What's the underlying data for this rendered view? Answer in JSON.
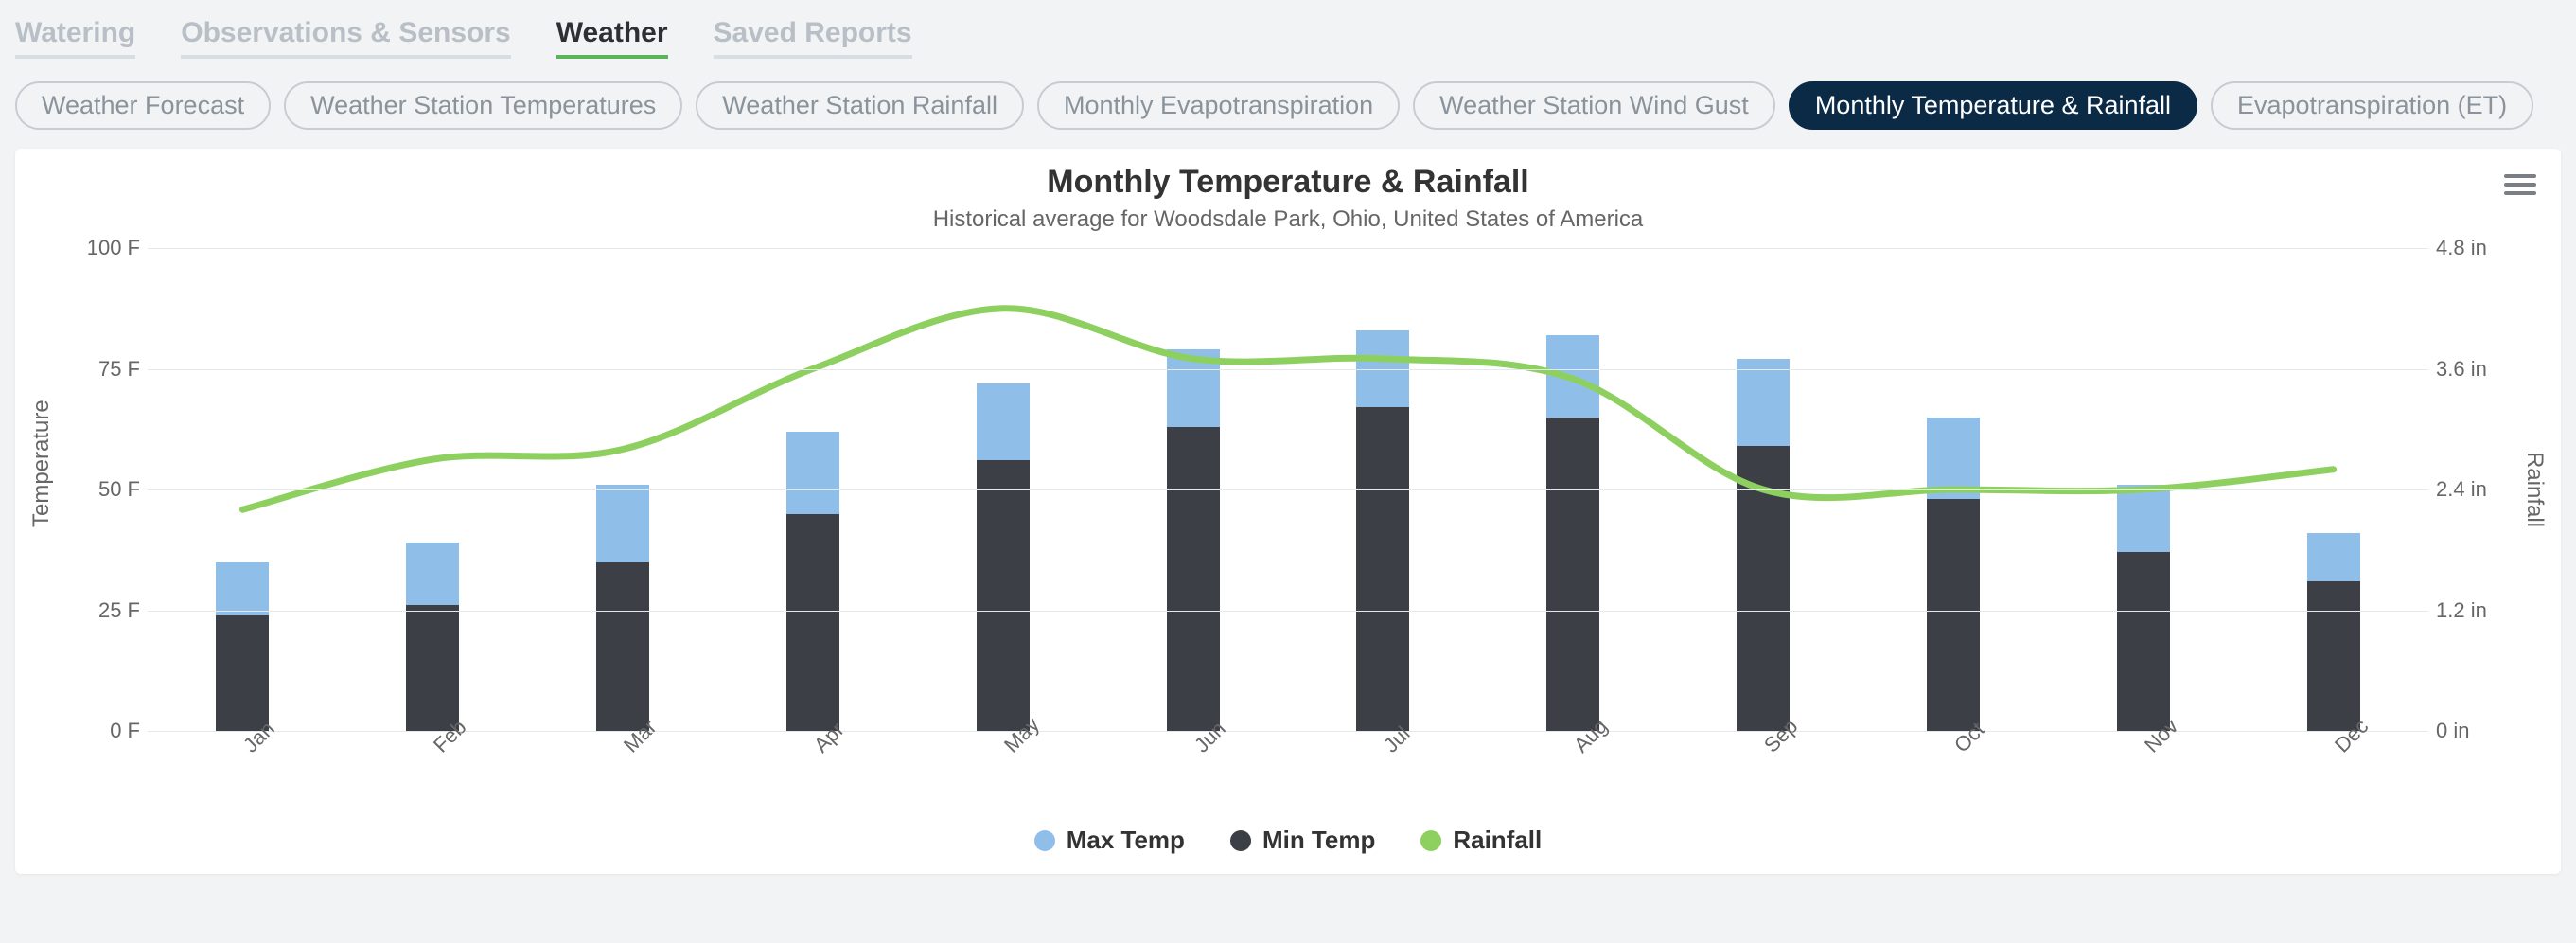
{
  "nav": {
    "tabs": [
      {
        "label": "Watering",
        "active": false
      },
      {
        "label": "Observations & Sensors",
        "active": false
      },
      {
        "label": "Weather",
        "active": true
      },
      {
        "label": "Saved Reports",
        "active": false
      }
    ]
  },
  "pills": [
    {
      "label": "Weather Forecast",
      "active": false
    },
    {
      "label": "Weather Station Temperatures",
      "active": false
    },
    {
      "label": "Weather Station Rainfall",
      "active": false
    },
    {
      "label": "Monthly Evapotranspiration",
      "active": false
    },
    {
      "label": "Weather Station Wind Gust",
      "active": false
    },
    {
      "label": "Monthly Temperature & Rainfall",
      "active": true
    },
    {
      "label": "Evapotranspiration (ET)",
      "active": false
    }
  ],
  "chart": {
    "title": "Monthly Temperature & Rainfall",
    "subtitle": "Historical average for Woodsdale Park, Ohio, United States of America",
    "yLeft": {
      "title": "Temperature",
      "min": 0,
      "max": 100,
      "unit": "F",
      "ticks": [
        0,
        25,
        50,
        75,
        100
      ]
    },
    "yRight": {
      "title": "Rainfall",
      "min": 0,
      "max": 4.8,
      "unit": "in",
      "ticks": [
        0,
        1.2,
        2.4,
        3.6,
        4.8
      ]
    },
    "legend": {
      "max": "Max Temp",
      "min": "Min Temp",
      "rain": "Rainfall"
    }
  },
  "chart_data": {
    "type": "bar+line",
    "title": "Monthly Temperature & Rainfall",
    "subtitle": "Historical average for Woodsdale Park, Ohio, United States of America",
    "xlabel": "",
    "ylabel_left": "Temperature",
    "ylabel_right": "Rainfall",
    "ylim_left": [
      0,
      100
    ],
    "ylim_right": [
      0,
      4.8
    ],
    "y_left_unit": "F",
    "y_right_unit": "in",
    "categories": [
      "Jan",
      "Feb",
      "Mar",
      "Apr",
      "May",
      "Jun",
      "Jul",
      "Aug",
      "Sep",
      "Oct",
      "Nov",
      "Dec"
    ],
    "series": [
      {
        "name": "Max Temp",
        "type": "bar",
        "axis": "left",
        "color": "#8fbfe8",
        "values": [
          35,
          39,
          51,
          62,
          72,
          79,
          83,
          82,
          77,
          65,
          51,
          41
        ]
      },
      {
        "name": "Min Temp",
        "type": "bar",
        "axis": "left",
        "color": "#3c3f46",
        "values": [
          24,
          26,
          35,
          45,
          56,
          63,
          67,
          65,
          59,
          48,
          37,
          31
        ]
      },
      {
        "name": "Rainfall",
        "type": "line",
        "axis": "right",
        "color": "#8ed060",
        "values": [
          2.2,
          2.7,
          2.8,
          3.6,
          4.2,
          3.7,
          3.7,
          3.5,
          2.4,
          2.4,
          2.4,
          2.6
        ]
      }
    ],
    "grid": true,
    "legend_position": "bottom"
  }
}
